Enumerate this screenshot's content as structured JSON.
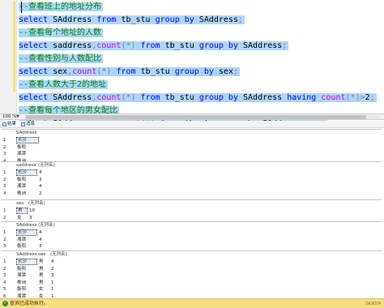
{
  "editor": {
    "lines": [
      {
        "comment": "--查看班上的地址分布"
      },
      {
        "tokens": [
          {
            "t": "select",
            "c": "kw"
          },
          {
            "t": " SAddress ",
            "c": "id"
          },
          {
            "t": "from",
            "c": "kw"
          },
          {
            "t": " tb_stu ",
            "c": "id"
          },
          {
            "t": "group by",
            "c": "kw"
          },
          {
            "t": " SAddress",
            "c": "id"
          },
          {
            "t": ";",
            "c": "op"
          }
        ]
      },
      {
        "comment": "--查看每个地址的人数"
      },
      {
        "tokens": [
          {
            "t": "select",
            "c": "kw"
          },
          {
            "t": " saddress",
            "c": "id"
          },
          {
            "t": ",",
            "c": "op"
          },
          {
            "t": "count",
            "c": "fn"
          },
          {
            "t": "(*)",
            "c": "op"
          },
          {
            "t": " ",
            "c": "id"
          },
          {
            "t": "from",
            "c": "kw"
          },
          {
            "t": " tb_stu ",
            "c": "id"
          },
          {
            "t": "group by",
            "c": "kw"
          },
          {
            "t": " SAddress",
            "c": "id"
          },
          {
            "t": ";",
            "c": "op"
          }
        ]
      },
      {
        "comment": "--查看性别与人数配比"
      },
      {
        "tokens": [
          {
            "t": "select",
            "c": "kw"
          },
          {
            "t": " sex",
            "c": "id"
          },
          {
            "t": ",",
            "c": "op"
          },
          {
            "t": "count",
            "c": "fn"
          },
          {
            "t": "(*)",
            "c": "op"
          },
          {
            "t": " ",
            "c": "id"
          },
          {
            "t": "from",
            "c": "kw"
          },
          {
            "t": " tb_stu ",
            "c": "id"
          },
          {
            "t": "group by",
            "c": "kw"
          },
          {
            "t": " sex",
            "c": "id"
          },
          {
            "t": ";",
            "c": "op"
          }
        ]
      },
      {
        "comment": "--查看人数大于2的地址"
      },
      {
        "tokens": [
          {
            "t": "select",
            "c": "kw"
          },
          {
            "t": " SAddress",
            "c": "id"
          },
          {
            "t": ",",
            "c": "op"
          },
          {
            "t": "count",
            "c": "fn"
          },
          {
            "t": "(*)",
            "c": "op"
          },
          {
            "t": " ",
            "c": "id"
          },
          {
            "t": "from",
            "c": "kw"
          },
          {
            "t": " tb_stu ",
            "c": "id"
          },
          {
            "t": "group by",
            "c": "kw"
          },
          {
            "t": " SAddress ",
            "c": "id"
          },
          {
            "t": "having",
            "c": "kw"
          },
          {
            "t": " ",
            "c": "id"
          },
          {
            "t": "count",
            "c": "fn"
          },
          {
            "t": "(*)",
            "c": "op"
          },
          {
            "t": ">",
            "c": "op"
          },
          {
            "t": "2",
            "c": "id"
          },
          {
            "t": ";",
            "c": "op"
          }
        ]
      },
      {
        "comment": "--查看每个地区的男女配比"
      },
      {
        "tokens": [
          {
            "t": "select",
            "c": "kw"
          },
          {
            "t": " SAddress",
            "c": "id"
          },
          {
            "t": ",",
            "c": "op"
          },
          {
            "t": "sex",
            "c": "id"
          },
          {
            "t": ",",
            "c": "op"
          },
          {
            "t": "count",
            "c": "fn"
          },
          {
            "t": "(*)",
            "c": "op"
          },
          {
            "t": " ",
            "c": "id"
          },
          {
            "t": "from",
            "c": "kw"
          },
          {
            "t": " tb_stu ",
            "c": "id"
          },
          {
            "t": "group by",
            "c": "kw"
          },
          {
            "t": " SAddress",
            "c": "id"
          },
          {
            "t": ",",
            "c": "op"
          },
          {
            "t": "sex",
            "c": "id"
          },
          {
            "t": ";",
            "c": "op"
          }
        ]
      }
    ]
  },
  "zoom": {
    "label": "100 %"
  },
  "tabs": {
    "results_label": "结果",
    "messages_label": "消息"
  },
  "results": [
    {
      "headers": [
        "SAddress"
      ],
      "rows": [
        [
          "长沙"
        ],
        [
          "衡阳"
        ],
        [
          "湘潭"
        ],
        [
          "株洲"
        ]
      ]
    },
    {
      "headers": [
        "saddress",
        "(无列名)"
      ],
      "rows": [
        [
          "长沙",
          "4"
        ],
        [
          "衡阳",
          "3"
        ],
        [
          "湘潭",
          "4"
        ],
        [
          "株洲",
          "2"
        ]
      ]
    },
    {
      "headers": [
        "sex",
        "(无列名)"
      ],
      "rows": [
        [
          "男",
          "10"
        ],
        [
          "女",
          "3"
        ]
      ]
    },
    {
      "headers": [
        "SAddress",
        "(无列名)"
      ],
      "rows": [
        [
          "长沙",
          "4"
        ],
        [
          "湘潭",
          "4"
        ],
        [
          "衡阳",
          "3"
        ]
      ]
    },
    {
      "headers": [
        "SAddress",
        "sex",
        "(无列名)"
      ],
      "rows": [
        [
          "长沙",
          "男",
          "4"
        ],
        [
          "衡阳",
          "男",
          "2"
        ],
        [
          "湘潭",
          "男",
          "3"
        ],
        [
          "株洲",
          "男",
          "1"
        ],
        [
          "衡阳",
          "女",
          "1"
        ],
        [
          "湘潭",
          "女",
          "1"
        ]
      ]
    }
  ],
  "status": {
    "text": "查询已成功执行。",
    "icon": "check-icon",
    "right": "DESKTOP"
  }
}
